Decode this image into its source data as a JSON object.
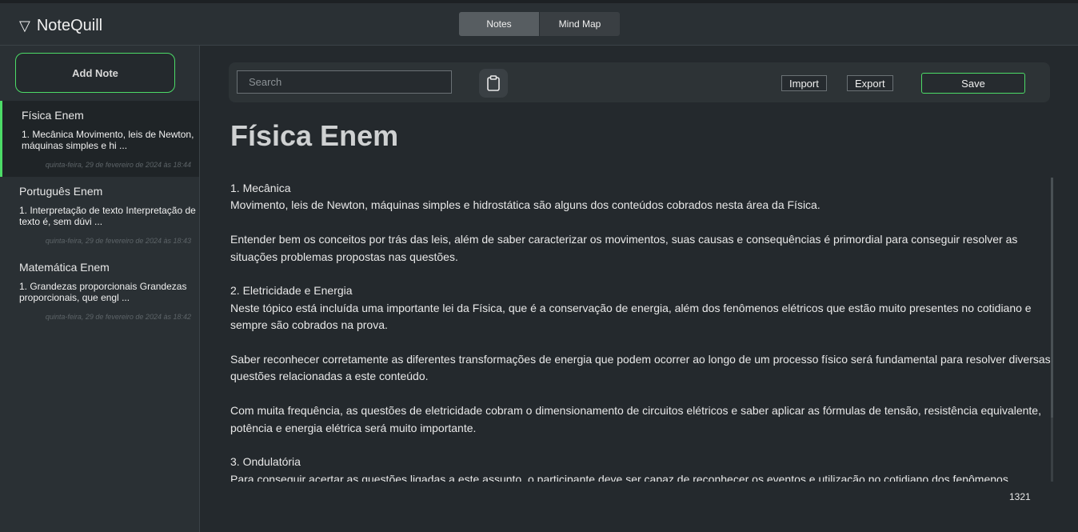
{
  "app": {
    "name": "NoteQuill",
    "brand_icon": "▽"
  },
  "view_tabs": [
    {
      "label": "Notes",
      "active": true
    },
    {
      "label": "Mind Map",
      "active": false
    }
  ],
  "sidebar": {
    "add_note_label": "Add Note",
    "notes": [
      {
        "title": "Física Enem",
        "preview": "1. Mecânica Movimento, leis de Newton, máquinas simples e hi ...",
        "date": "quinta-feira, 29 de fevereiro de 2024 às 18:44",
        "active": true
      },
      {
        "title": "Português Enem",
        "preview": "1. Interpretação de texto Interpretação de texto é, sem dúvi ...",
        "date": "quinta-feira, 29 de fevereiro de 2024 às 18:43",
        "active": false
      },
      {
        "title": "Matemática Enem",
        "preview": "1. Grandezas proporcionais Grandezas proporcionais, que engl ...",
        "date": "quinta-feira, 29 de fevereiro de 2024 às 18:42",
        "active": false
      }
    ]
  },
  "toolbar": {
    "search_placeholder": "Search",
    "import_label": "Import",
    "export_label": "Export",
    "save_label": "Save"
  },
  "editor": {
    "title": "Física Enem",
    "paragraphs": [
      {
        "lines": [
          "1. Mecânica",
          "Movimento, leis de Newton, máquinas simples e hidrostática são alguns dos conteúdos cobrados nesta área da Física."
        ]
      },
      {
        "lines": [
          "Entender bem os conceitos por trás das leis, além de saber caracterizar os movimentos, suas causas e consequências é primordial para conseguir resolver as situações problemas propostas nas questões."
        ]
      },
      {
        "lines": [
          "2. Eletricidade e Energia",
          "Neste tópico está incluída uma importante lei da Física, que é a conservação de energia, além dos fenômenos elétricos que estão muito presentes no cotidiano e sempre são cobrados na prova."
        ]
      },
      {
        "lines": [
          "Saber reconhecer corretamente as diferentes transformações de energia que podem ocorrer ao longo de um processo físico será fundamental para resolver diversas questões relacionadas a este conteúdo."
        ]
      },
      {
        "lines": [
          "Com muita frequência, as questões de eletricidade cobram o dimensionamento de circuitos elétricos e saber aplicar as fórmulas de tensão, resistência equivalente, potência e energia elétrica será muito importante."
        ]
      },
      {
        "lines": [
          "3. Ondulatória",
          "Para conseguir acertar as questões ligadas a este assunto, o participante deve ser capaz de reconhecer os eventos e utilização no cotidiano dos fenômenos"
        ]
      }
    ],
    "char_count": "1321"
  },
  "colors": {
    "accent": "#4cdb67",
    "background": "#24292d",
    "panel": "#2a3034"
  }
}
